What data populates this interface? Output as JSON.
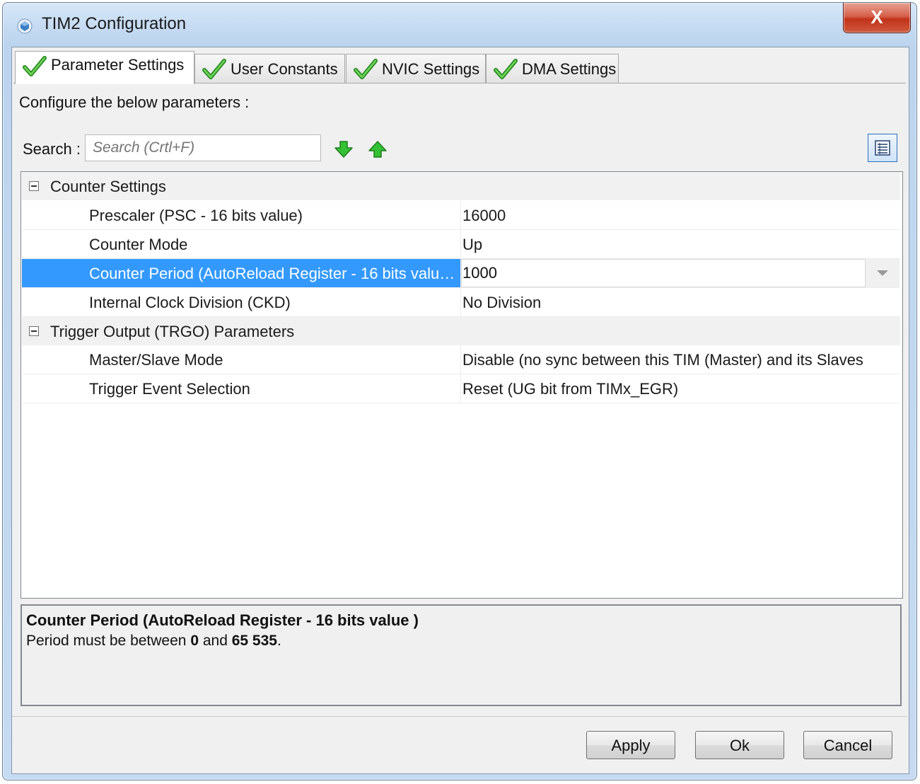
{
  "window": {
    "title": "TIM2 Configuration",
    "close_label": "X"
  },
  "tabs": [
    {
      "label": "Parameter Settings",
      "active": true
    },
    {
      "label": "User Constants",
      "active": false
    },
    {
      "label": "NVIC Settings",
      "active": false
    },
    {
      "label": "DMA Settings",
      "active": false
    }
  ],
  "panel": {
    "instructions": "Configure the below parameters :",
    "search_label": "Search :",
    "search_placeholder": "Search (Crtl+F)",
    "search_value": ""
  },
  "groups": [
    {
      "name": "Counter Settings",
      "expanded": true,
      "rows": [
        {
          "name": "Prescaler (PSC - 16 bits value)",
          "value": "16000"
        },
        {
          "name": "Counter Mode",
          "value": "Up"
        },
        {
          "name": "Counter Period (AutoReload Register - 16 bits valu…",
          "value": "1000",
          "selected": true
        },
        {
          "name": "Internal Clock Division (CKD)",
          "value": "No Division"
        }
      ]
    },
    {
      "name": "Trigger Output (TRGO) Parameters",
      "expanded": true,
      "rows": [
        {
          "name": "Master/Slave Mode",
          "value": "Disable (no sync between this TIM (Master) and its Slaves"
        },
        {
          "name": "Trigger Event Selection",
          "value": "Reset (UG bit from TIMx_EGR)"
        }
      ]
    }
  ],
  "description": {
    "title": "Counter Period (AutoReload Register - 16 bits value )",
    "text_prefix": "Period must be between ",
    "min": "0",
    "text_mid": " and ",
    "max": "65 535",
    "text_suffix": "."
  },
  "buttons": {
    "apply": "Apply",
    "ok": "Ok",
    "cancel": "Cancel"
  },
  "colors": {
    "selection": "#3399ff",
    "check_green": "#3aa82e",
    "arrow_green": "#2fb52f"
  },
  "icons": {
    "tab_status": "check-icon",
    "search_next": "arrow-down-icon",
    "search_prev": "arrow-up-icon",
    "view_toggle": "list-view-icon",
    "title": "app-icon"
  }
}
